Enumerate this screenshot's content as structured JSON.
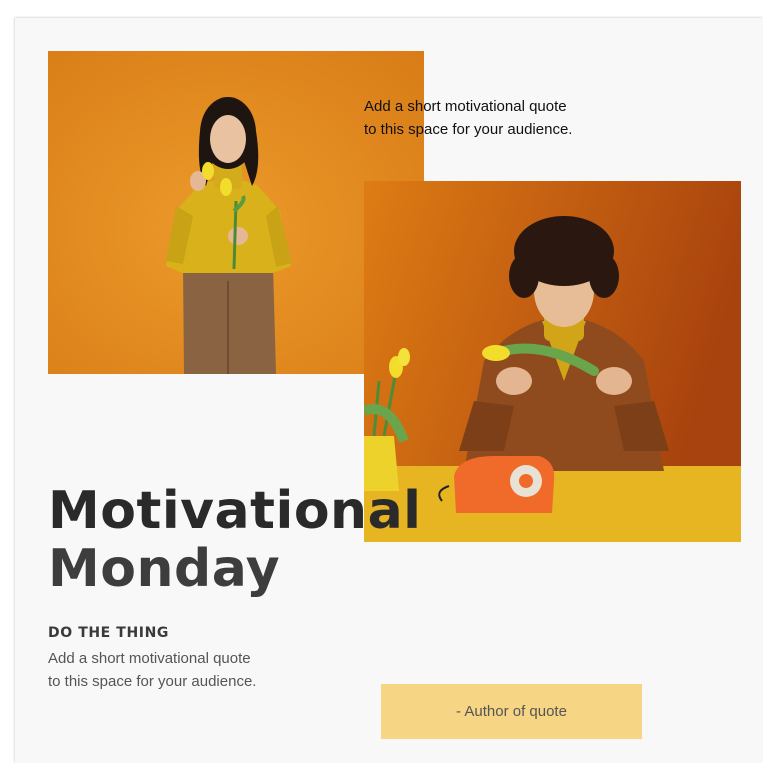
{
  "quote_top": "Add a short motivational quote\nto this space for your audience.",
  "title": {
    "line1": "Motivational",
    "line2": "Monday"
  },
  "subhead": "DO THE THING",
  "quote_bottom": "Add a short motivational quote\nto this space for your audience.",
  "author": "- Author of quote",
  "colors": {
    "card_bg": "#f8f8f8",
    "author_box": "#f6d684",
    "orange_bg": "#e08a1a",
    "rust_bg": "#c85a12",
    "mustard": "#e5b21f",
    "phone": "#f06a2a"
  },
  "images": [
    {
      "name": "woman-with-tulips-photo"
    },
    {
      "name": "man-with-tulip-and-phone-photo"
    }
  ]
}
